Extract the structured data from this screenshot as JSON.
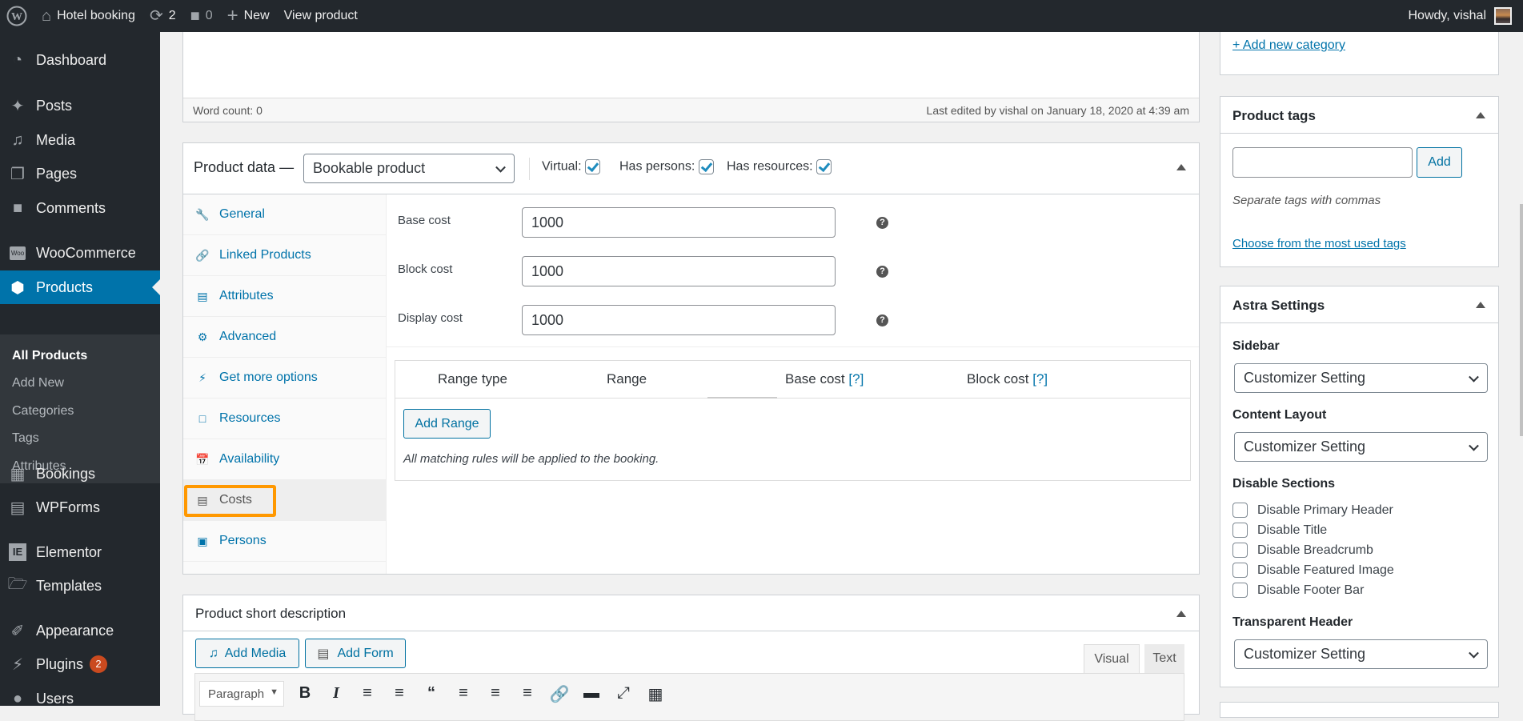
{
  "adminbar": {
    "site_name": "Hotel booking",
    "updates_count": "2",
    "comments_count": "0",
    "new_label": "New",
    "view_label": "View product",
    "howdy": "Howdy, vishal"
  },
  "menu": {
    "items": [
      {
        "label": "Dashboard",
        "icon": "dashboard-icon"
      },
      {
        "label": "Posts",
        "icon": "pin-icon"
      },
      {
        "label": "Media",
        "icon": "media-icon"
      },
      {
        "label": "Pages",
        "icon": "pages-icon"
      },
      {
        "label": "Comments",
        "icon": "comment-icon"
      },
      {
        "label": "WooCommerce",
        "icon": "woo-icon"
      },
      {
        "label": "Products",
        "icon": "box-icon"
      },
      {
        "label": "Bookings",
        "icon": "calendar-icon"
      },
      {
        "label": "WPForms",
        "icon": "form-icon"
      },
      {
        "label": "Elementor",
        "icon": "elementor-icon"
      },
      {
        "label": "Templates",
        "icon": "folder-icon"
      },
      {
        "label": "Appearance",
        "icon": "brush-icon"
      },
      {
        "label": "Plugins",
        "icon": "plugin-icon",
        "badge": "2"
      },
      {
        "label": "Users",
        "icon": "user-icon"
      }
    ],
    "submenu": [
      "All Products",
      "Add New",
      "Categories",
      "Tags",
      "Attributes"
    ]
  },
  "editor_status": {
    "word_count": "Word count: 0",
    "last_edited": "Last edited by vishal on January 18, 2020 at 4:39 am"
  },
  "product_data": {
    "title": "Product data —",
    "type_selected": "Bookable product",
    "virtual_label": "Virtual:",
    "virtual_checked": true,
    "has_persons_label": "Has persons:",
    "has_persons_checked": true,
    "has_resources_label": "Has resources:",
    "has_resources_checked": true,
    "tabs": [
      {
        "label": "General",
        "icon": "wrench-icon"
      },
      {
        "label": "Linked Products",
        "icon": "link-icon"
      },
      {
        "label": "Attributes",
        "icon": "list-icon"
      },
      {
        "label": "Advanced",
        "icon": "gear-icon"
      },
      {
        "label": "Get more options",
        "icon": "plugin-icon"
      },
      {
        "label": "Resources",
        "icon": "window-icon"
      },
      {
        "label": "Availability",
        "icon": "calendar-icon"
      },
      {
        "label": "Costs",
        "icon": "card-icon",
        "active": true
      },
      {
        "label": "Persons",
        "icon": "person-icon"
      }
    ],
    "fields": [
      {
        "label": "Base cost",
        "value": "1000"
      },
      {
        "label": "Block cost",
        "value": "1000"
      },
      {
        "label": "Display cost",
        "value": "1000"
      }
    ],
    "range_table": {
      "columns": [
        "Range type",
        "Range",
        "Base cost",
        "Block cost"
      ],
      "help_marker": "[?]",
      "add_range": "Add Range",
      "note": "All matching rules will be applied to the booking."
    }
  },
  "short_description": {
    "title": "Product short description",
    "add_media": "Add Media",
    "add_form": "Add Form",
    "tab_visual": "Visual",
    "tab_text": "Text",
    "format_select": "Paragraph"
  },
  "sidebar_right": {
    "add_category": "+ Add new category",
    "tags": {
      "title": "Product tags",
      "input_value": "",
      "add_button": "Add",
      "hint": "Separate tags with commas",
      "choose_link": "Choose from the most used tags"
    },
    "astra": {
      "title": "Astra Settings",
      "sidebar_label": "Sidebar",
      "sidebar_value": "Customizer Setting",
      "content_layout_label": "Content Layout",
      "content_layout_value": "Customizer Setting",
      "disable_sections_label": "Disable Sections",
      "disable_options": [
        "Disable Primary Header",
        "Disable Title",
        "Disable Breadcrumb",
        "Disable Featured Image",
        "Disable Footer Bar"
      ],
      "transparent_header_label": "Transparent Header",
      "transparent_header_value": "Customizer Setting"
    }
  },
  "colors": {
    "accent": "#0073aa",
    "highlight": "#ff9800",
    "adminbar": "#23282d"
  }
}
